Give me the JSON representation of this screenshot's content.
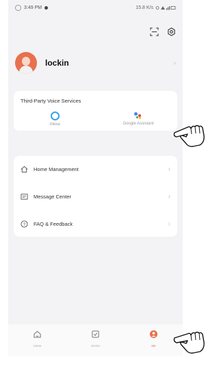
{
  "status_bar": {
    "time": "3:49 PM",
    "indicators": "15.8 K/s"
  },
  "profile": {
    "username": "lockin"
  },
  "voice_services": {
    "title": "Third-Party Voice Services",
    "services": [
      {
        "label": "Alexa",
        "icon": "alexa-icon"
      },
      {
        "label": "Google Assistant",
        "icon": "google-assistant-icon"
      }
    ]
  },
  "menu": {
    "items": [
      {
        "label": "Home Management",
        "icon": "home-icon"
      },
      {
        "label": "Message Center",
        "icon": "message-icon"
      },
      {
        "label": "FAQ & Feedback",
        "icon": "faq-icon"
      }
    ]
  },
  "tabs": [
    {
      "label": "Home",
      "icon": "home-tab-icon",
      "active": false
    },
    {
      "label": "Scene",
      "icon": "scene-tab-icon",
      "active": false
    },
    {
      "label": "Me",
      "icon": "me-tab-icon",
      "active": true
    }
  ],
  "colors": {
    "accent": "#e8704e",
    "alexa": "#39a3e6",
    "background": "#f3f3f5"
  }
}
